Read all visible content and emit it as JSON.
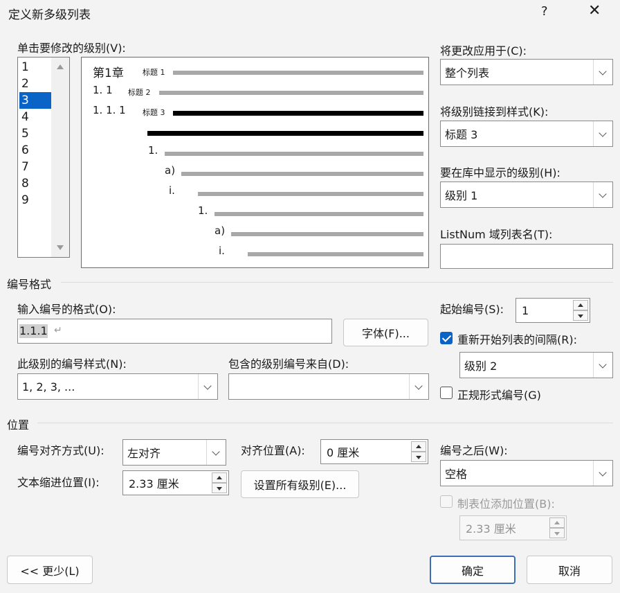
{
  "title": "定义新多级列表",
  "title_help": "?",
  "levels_label": "单击要修改的级别(V):",
  "levels": [
    "1",
    "2",
    "3",
    "4",
    "5",
    "6",
    "7",
    "8",
    "9"
  ],
  "selected_level": "3",
  "preview": {
    "row1": {
      "num": "第1章",
      "style": "标题 1"
    },
    "row2": {
      "num": "1. 1",
      "style": "标题 2"
    },
    "row3": {
      "num": "1. 1. 1",
      "style": "标题 3"
    },
    "rows": [
      "1.",
      "a)",
      "i.",
      "1.",
      "a)",
      "i."
    ]
  },
  "apply_to": {
    "label": "将更改应用于(C):",
    "value": "整个列表"
  },
  "link_style": {
    "label": "将级别链接到样式(K):",
    "value": "标题 3"
  },
  "gallery_level": {
    "label": "要在库中显示的级别(H):",
    "value": "级别 1"
  },
  "listnum": {
    "label": "ListNum 域列表名(T):",
    "value": ""
  },
  "numbering_format": {
    "section": "编号格式",
    "format_label": "输入编号的格式(O):",
    "format_value": "1.1.1",
    "format_mark": "↵",
    "font_button": "字体(F)...",
    "style_label": "此级别的编号样式(N):",
    "style_value": "1, 2, 3, ...",
    "include_label": "包含的级别编号来自(D):",
    "include_value": ""
  },
  "start_at": {
    "label": "起始编号(S):",
    "value": "1"
  },
  "restart": {
    "label": "重新开始列表的间隔(R):",
    "checked": true,
    "value": "级别 2"
  },
  "legal": {
    "label": "正规形式编号(G)",
    "checked": false
  },
  "position": {
    "section": "位置",
    "align_label": "编号对齐方式(U):",
    "align_value": "左对齐",
    "align_at_label": "对齐位置(A):",
    "align_at_value": "0 厘米",
    "indent_label": "文本缩进位置(I):",
    "indent_value": "2.33 厘米",
    "set_all_button": "设置所有级别(E)...",
    "follow_label": "编号之后(W):",
    "follow_value": "空格",
    "tab_stop_label": "制表位添加位置(B):",
    "tab_stop_checked": false,
    "tab_stop_value": "2.33 厘米"
  },
  "buttons": {
    "less": "<< 更少(L)",
    "ok": "确定",
    "cancel": "取消"
  }
}
